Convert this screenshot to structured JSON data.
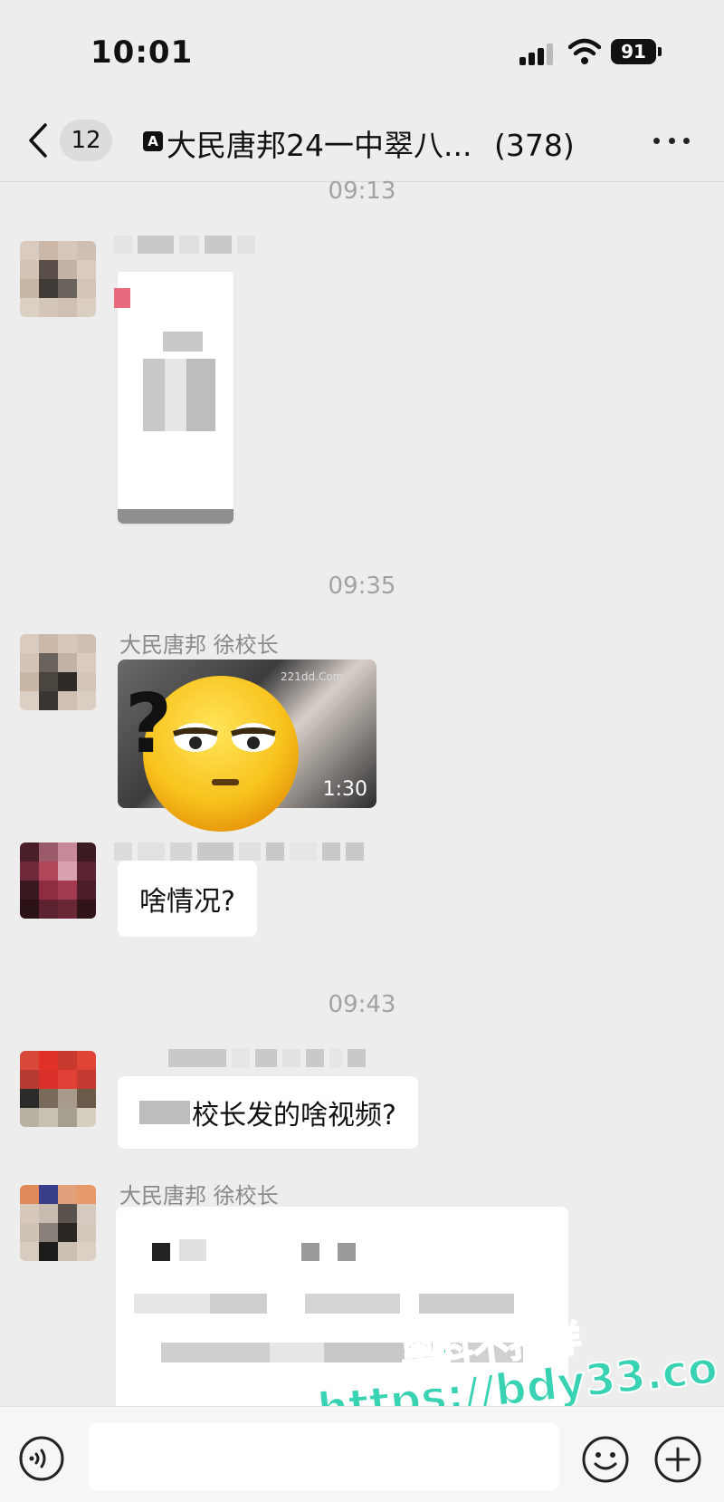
{
  "status_bar": {
    "time": "10:01",
    "battery": "91"
  },
  "nav": {
    "unread_count": "12",
    "group_tag": "A",
    "title": "大民唐邦24一中翠八...",
    "member_count": "(378)"
  },
  "messages": [
    {
      "type": "timestamp",
      "text": "09:13"
    },
    {
      "type": "image-doc",
      "sender": ""
    },
    {
      "type": "timestamp",
      "text": "09:35"
    },
    {
      "type": "video",
      "sender": "大民唐邦 徐校长",
      "duration": "1:30",
      "watermark": "221dd.Com"
    },
    {
      "type": "text",
      "sender": "",
      "text": "啥情况?"
    },
    {
      "type": "timestamp",
      "text": "09:43"
    },
    {
      "type": "text",
      "sender": "",
      "text": "校长发的啥视频?"
    },
    {
      "type": "file",
      "sender": "大民唐邦 徐校长"
    }
  ],
  "watermark": {
    "line1": "黑料不打烊",
    "line2": "https://bdy33.co"
  },
  "input_bar": {
    "icons": [
      "voice-icon",
      "emoji-icon",
      "plus-icon"
    ]
  },
  "colors": {
    "background": "#ededed",
    "bubble": "#ffffff",
    "watermark": "#39d2b3"
  }
}
